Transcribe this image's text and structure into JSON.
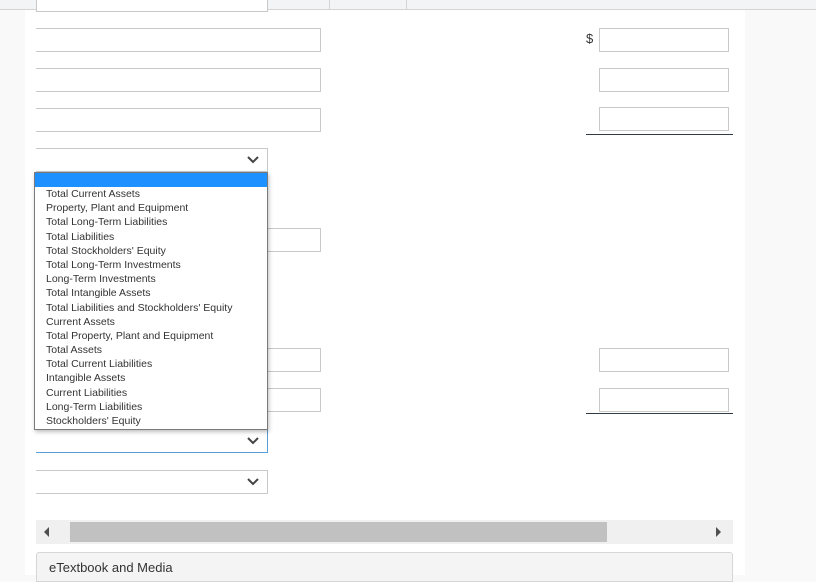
{
  "currency_symbol": "$",
  "dropdown": {
    "selected_index": 0,
    "options": [
      "",
      "Total Current Assets",
      "Property, Plant and Equipment",
      "Total Long-Term Liabilities",
      "Total Liabilities",
      "Total Stockholders' Equity",
      "Total Long-Term Investments",
      "Long-Term Investments",
      "Total Intangible Assets",
      "Total Liabilities and Stockholders' Equity",
      "Current Assets",
      "Total Property, Plant and Equipment",
      "Total Assets",
      "Total Current Liabilities",
      "Intangible Assets",
      "Current Liabilities",
      "Long-Term Liabilities",
      "Stockholders' Equity"
    ]
  },
  "inputs": {
    "left_1": "",
    "left_2": "",
    "left_3": "",
    "left_4": "",
    "left_5": "",
    "left_6": "",
    "right_1": "",
    "right_2": "",
    "right_3": "",
    "right_4": "",
    "right_5": ""
  },
  "footer": {
    "etextbook_label": "eTextbook and Media"
  },
  "colors": {
    "highlight": "#1e90ff",
    "focus_border": "#5b9bd5",
    "rule": "#2f3b45"
  }
}
